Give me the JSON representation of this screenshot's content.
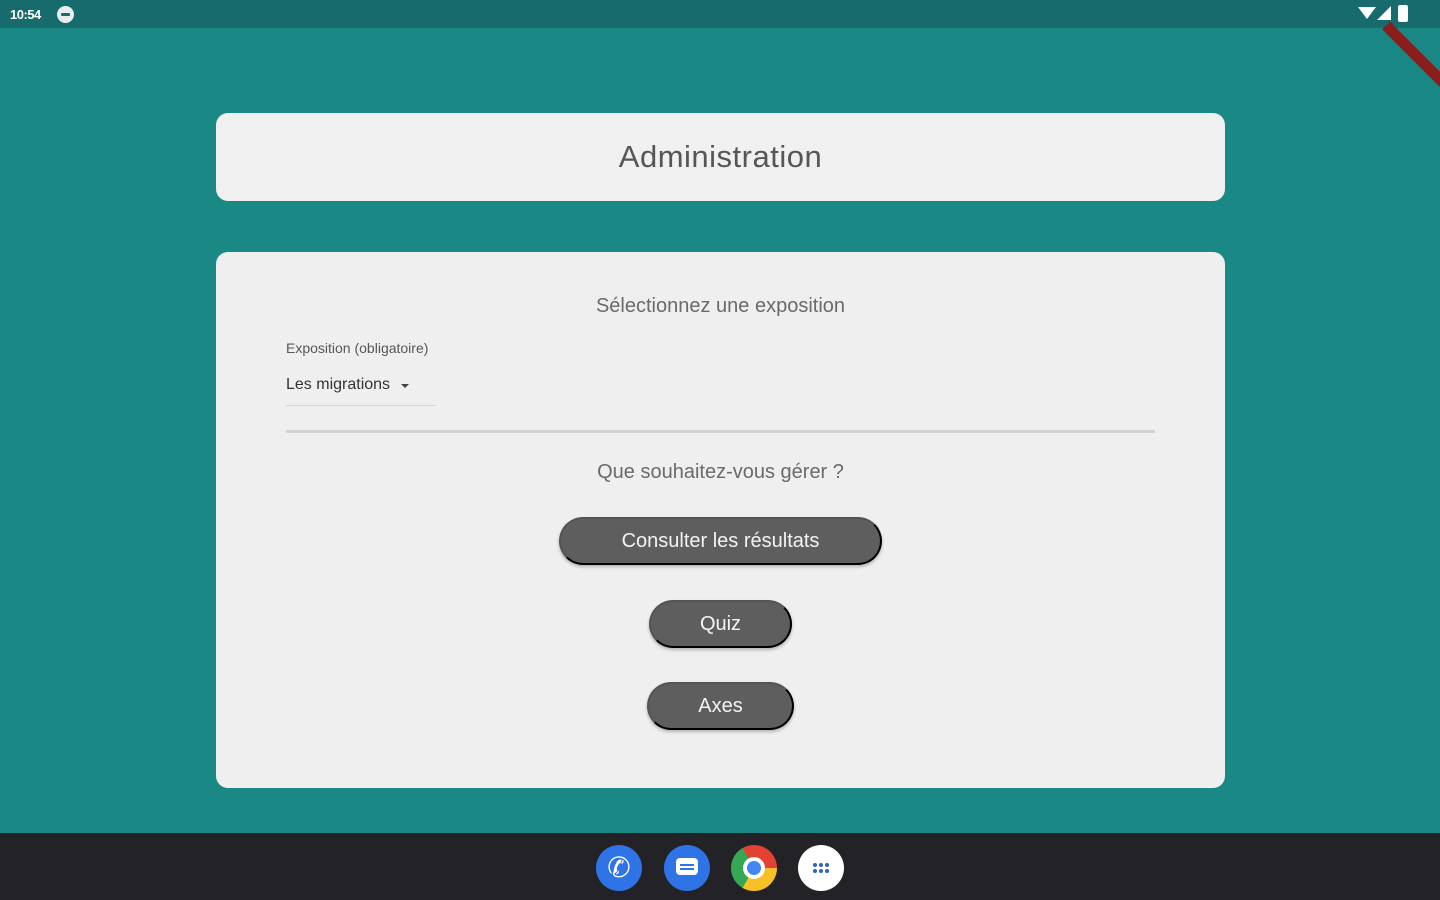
{
  "status_bar": {
    "time": "10:54",
    "icons": [
      "notification-icon",
      "wifi-icon",
      "signal-icon",
      "battery-icon"
    ]
  },
  "header": {
    "title": "Administration"
  },
  "main": {
    "select_prompt": "Sélectionnez une exposition",
    "exposition_field": {
      "label": "Exposition (obligatoire)",
      "selected_value": "Les migrations"
    },
    "manage_prompt": "Que souhaitez-vous gérer ?",
    "buttons": {
      "results": "Consulter les résultats",
      "quiz": "Quiz",
      "axes": "Axes"
    }
  },
  "dock": {
    "apps": [
      "phone-icon",
      "messages-icon",
      "chrome-icon",
      "app-drawer-icon"
    ]
  },
  "colors": {
    "background": "#1a8884",
    "status_bar": "#176b6d",
    "card": "#efefef",
    "button": "#5e5e5e",
    "taskbar": "#232226"
  }
}
